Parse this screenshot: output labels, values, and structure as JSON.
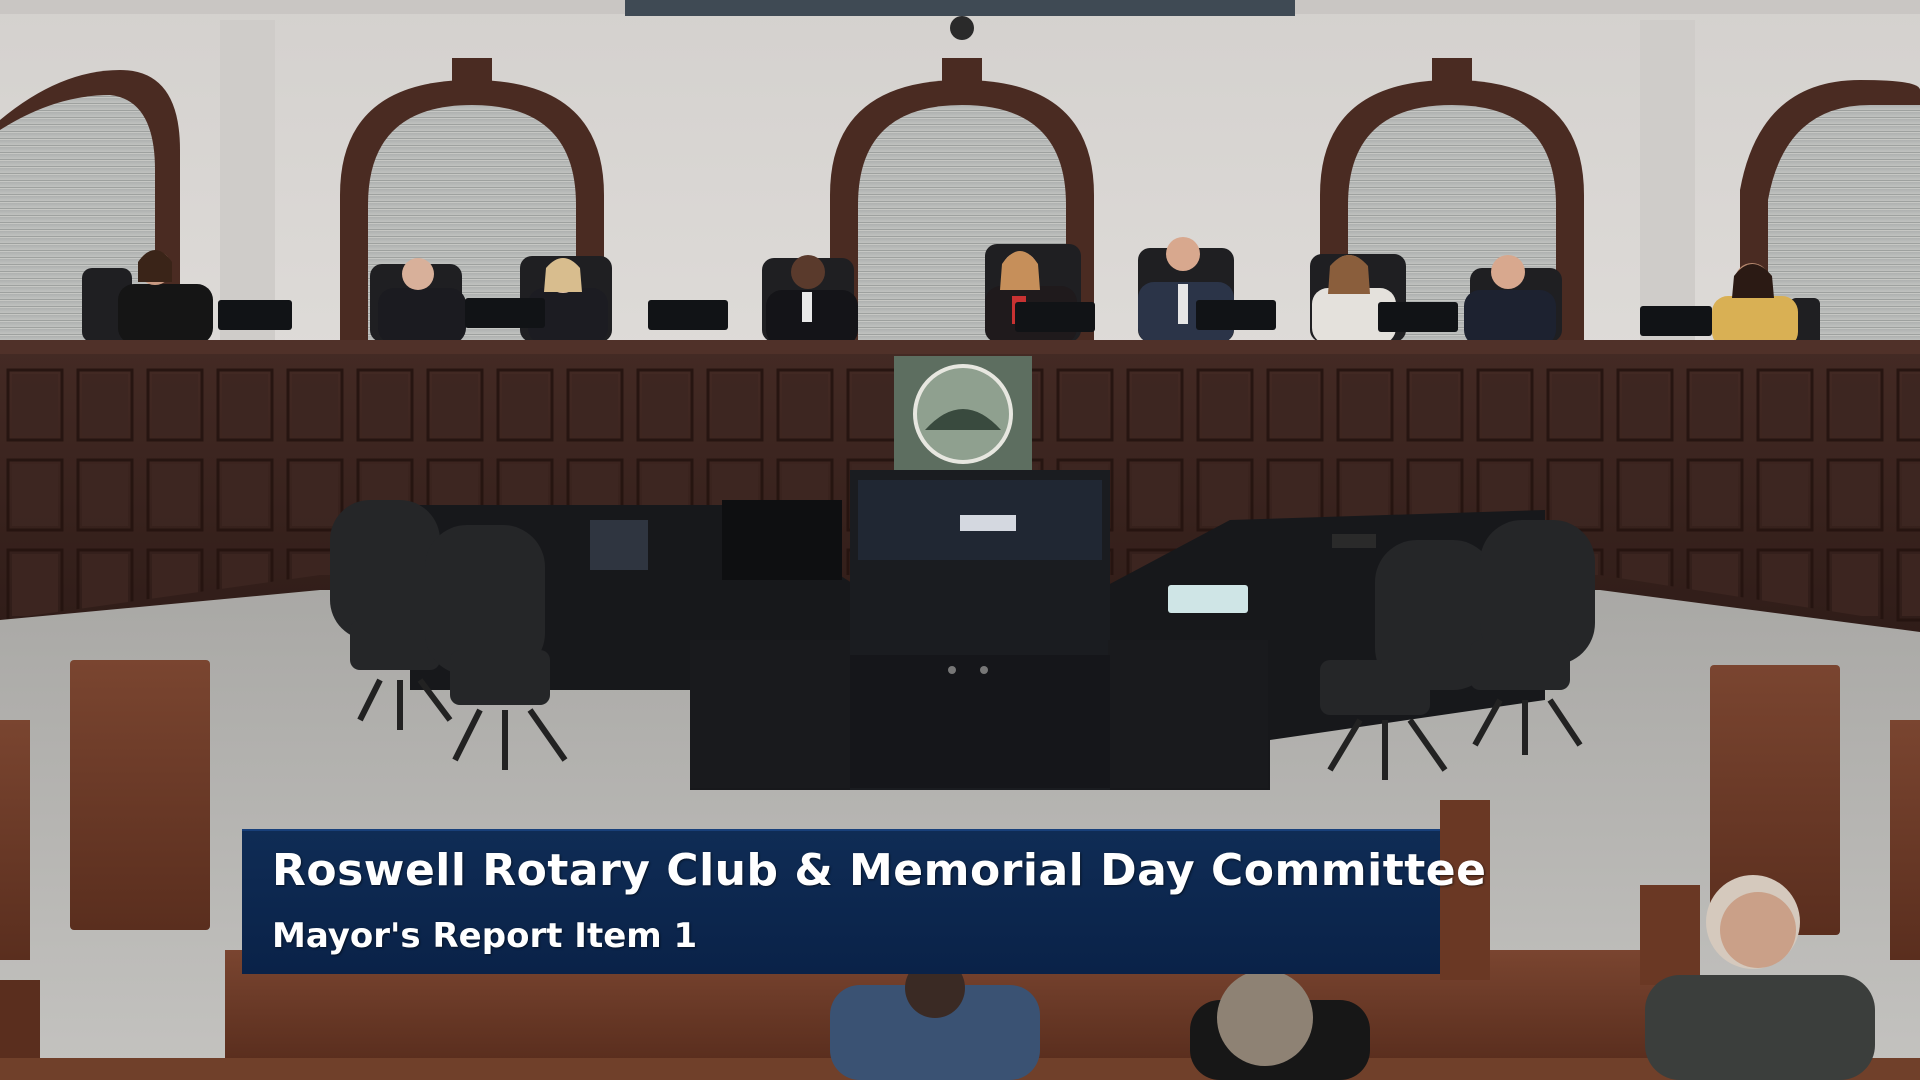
{
  "lower_third": {
    "title": "Roswell Rotary Club & Memorial Day Committee",
    "subtitle": "Mayor's Report Item 1"
  },
  "colors": {
    "wall": "#d9d6d3",
    "wood_dark": "#3b2420",
    "wood_pew": "#6b3a25",
    "carpet": "#b9b8b5",
    "banner": "#0b2349"
  }
}
